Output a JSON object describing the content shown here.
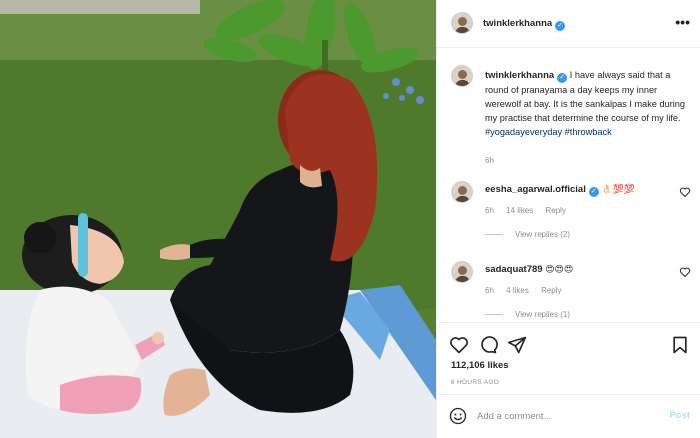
{
  "post": {
    "author": "twinklerkhanna",
    "verified_mark": "✓",
    "more_icon": "•••"
  },
  "caption": {
    "author": "twinklerkhanna",
    "text": "I have always said that a round of pranayama a day keeps my inner werewolf at bay. It is the sankalpas I make during my practise that determine the course of my life.",
    "hashtags": "#yogadayeveryday #throwback",
    "time": "6h"
  },
  "comments": [
    {
      "author": "eesha_agarwal.official",
      "emoji": "👌🏻💯💯",
      "time": "6h",
      "likes": "14 likes",
      "reply_label": "Reply",
      "view_replies": "View replies (2)"
    },
    {
      "author": "sadaquat789",
      "emoji": "😍😍😍",
      "time": "6h",
      "likes": "4 likes",
      "reply_label": "Reply",
      "view_replies": "View replies (1)"
    }
  ],
  "actions": {
    "likes": "112,106 likes",
    "time": "6 HOURS AGO"
  },
  "add_comment": {
    "placeholder": "Add a comment...",
    "post_label": "Post"
  },
  "colors": {
    "accent_blue": "#3897f0",
    "post_button": "#b2dffc",
    "hashtag": "#00376b",
    "muted_text": "#8e8e8e"
  },
  "icons": {
    "like": "heart-icon",
    "comment": "comment-icon",
    "share": "paper-plane-icon",
    "save": "bookmark-icon",
    "emoji": "smiley-icon",
    "more": "more-horizontal-icon"
  }
}
